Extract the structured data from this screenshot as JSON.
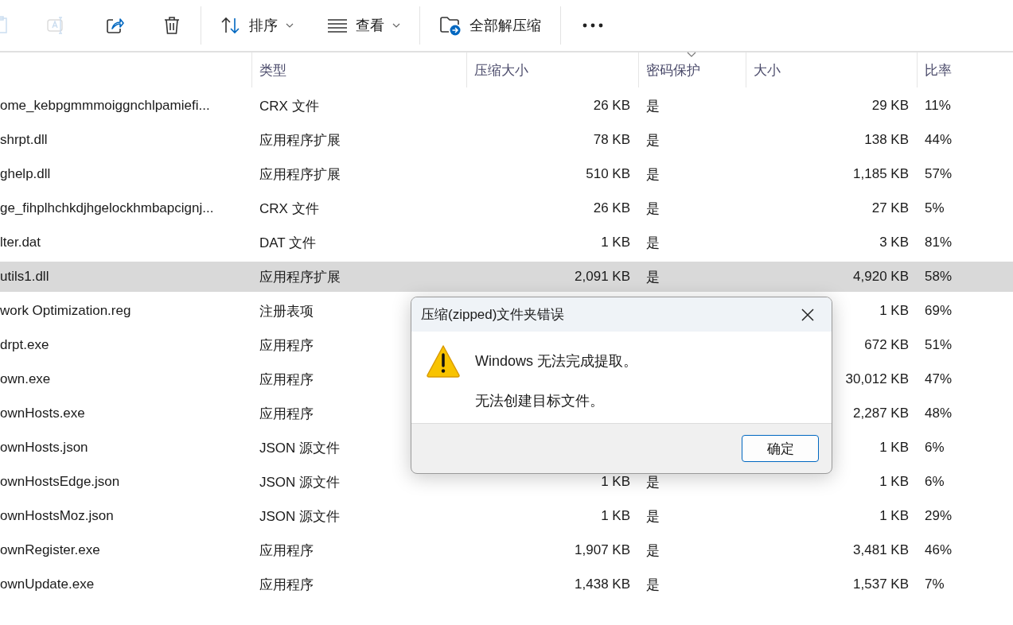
{
  "toolbar": {
    "icon_buttons": [
      {
        "disabled": true
      },
      {
        "disabled": true
      },
      {
        "disabled": false
      },
      {
        "disabled": false
      }
    ],
    "menu_buttons": [
      {
        "label": "排序",
        "dropdown": true
      },
      {
        "label": "查看",
        "dropdown": true
      },
      {
        "label": "全部解压缩",
        "dropdown": false
      }
    ]
  },
  "table": {
    "columns": [
      {
        "label": "类型",
        "sorted": false
      },
      {
        "label": "压缩大小",
        "sorted": false
      },
      {
        "label": "密码保护",
        "sorted": true
      },
      {
        "label": "大小",
        "sorted": false
      },
      {
        "label": "比率",
        "sorted": false
      }
    ],
    "rows": [
      {
        "name": "ome_kebpgmmmoiggnchlpamiefi...",
        "type": "CRX 文件",
        "compressed": "26 KB",
        "password": "是",
        "size": "29 KB",
        "ratio": "11%",
        "selected": false
      },
      {
        "name": "shrpt.dll",
        "type": "应用程序扩展",
        "compressed": "78 KB",
        "password": "是",
        "size": "138 KB",
        "ratio": "44%",
        "selected": false
      },
      {
        "name": "ghelp.dll",
        "type": "应用程序扩展",
        "compressed": "510 KB",
        "password": "是",
        "size": "1,185 KB",
        "ratio": "57%",
        "selected": false
      },
      {
        "name": "ge_fihplhchkdjhgelockhmbapcignj...",
        "type": "CRX 文件",
        "compressed": "26 KB",
        "password": "是",
        "size": "27 KB",
        "ratio": "5%",
        "selected": false
      },
      {
        "name": "lter.dat",
        "type": "DAT 文件",
        "compressed": "1 KB",
        "password": "是",
        "size": "3 KB",
        "ratio": "81%",
        "selected": false
      },
      {
        "name": "utils1.dll",
        "type": "应用程序扩展",
        "compressed": "2,091 KB",
        "password": "是",
        "size": "4,920 KB",
        "ratio": "58%",
        "selected": true
      },
      {
        "name": "work Optimization.reg",
        "type": "注册表项",
        "size": "1 KB",
        "ratio": "69%",
        "selected": false
      },
      {
        "name": "drpt.exe",
        "type": "应用程序",
        "size": "672 KB",
        "ratio": "51%",
        "selected": false
      },
      {
        "name": "own.exe",
        "type": "应用程序",
        "size": "30,012 KB",
        "ratio": "47%",
        "selected": false
      },
      {
        "name": "ownHosts.exe",
        "type": "应用程序",
        "size": "2,287 KB",
        "ratio": "48%",
        "selected": false
      },
      {
        "name": "ownHosts.json",
        "type": "JSON 源文件",
        "size": "1 KB",
        "ratio": "6%",
        "selected": false
      },
      {
        "name": "ownHostsEdge.json",
        "type": "JSON 源文件",
        "compressed": "1 KB",
        "password": "是",
        "size": "1 KB",
        "ratio": "6%",
        "selected": false
      },
      {
        "name": "ownHostsMoz.json",
        "type": "JSON 源文件",
        "compressed": "1 KB",
        "password": "是",
        "size": "1 KB",
        "ratio": "29%",
        "selected": false
      },
      {
        "name": "ownRegister.exe",
        "type": "应用程序",
        "compressed": "1,907 KB",
        "password": "是",
        "size": "3,481 KB",
        "ratio": "46%",
        "selected": false
      },
      {
        "name": "ownUpdate.exe",
        "type": "应用程序",
        "compressed": "1,438 KB",
        "password": "是",
        "size": "1,537 KB",
        "ratio": "7%",
        "selected": false
      }
    ]
  },
  "dialog": {
    "title": "压缩(zipped)文件夹错误",
    "message": "Windows 无法完成提取。",
    "detail": "无法创建目标文件。",
    "button": "确定"
  }
}
